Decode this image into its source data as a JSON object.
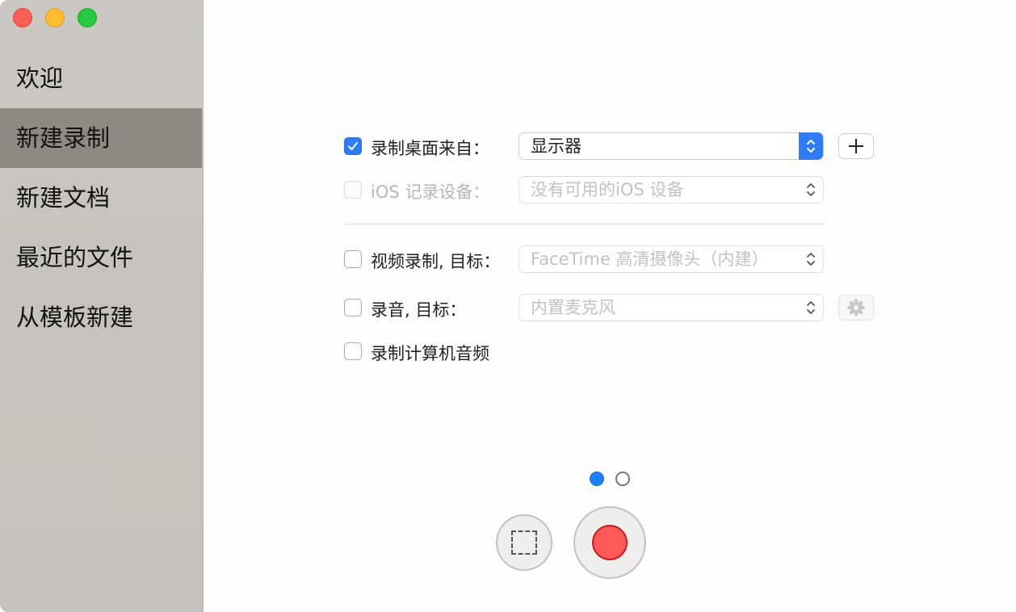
{
  "sidebar": {
    "items": [
      {
        "label": "欢迎",
        "active": false
      },
      {
        "label": "新建录制",
        "active": true
      },
      {
        "label": "新建文档",
        "active": false
      },
      {
        "label": "最近的文件",
        "active": false
      },
      {
        "label": "从模板新建",
        "active": false
      }
    ]
  },
  "options": {
    "record_desktop": {
      "label": "录制桌面来自：",
      "checked": true,
      "value": "显示器",
      "add_button": "plus-icon"
    },
    "ios_device": {
      "label": "iOS 记录设备：",
      "checked": false,
      "enabled": false,
      "value": "没有可用的iOS 设备"
    },
    "video_record": {
      "label": "视频录制, 目标：",
      "checked": false,
      "value": "FaceTime 高清摄像头（内建）"
    },
    "audio_record": {
      "label": "录音, 目标：",
      "checked": false,
      "value": "内置麦克风",
      "settings_button": "gear-icon"
    },
    "computer_audio": {
      "label": "录制计算机音频",
      "checked": false
    }
  },
  "pager": {
    "pages": 2,
    "current": 1
  },
  "controls": {
    "select_region_button": "dashed-rect-icon",
    "record_button": "record-icon"
  },
  "colors": {
    "accent": "#2f7cf6",
    "record_red": "#fe5a5a",
    "sidebar_active": "#8f8983"
  }
}
